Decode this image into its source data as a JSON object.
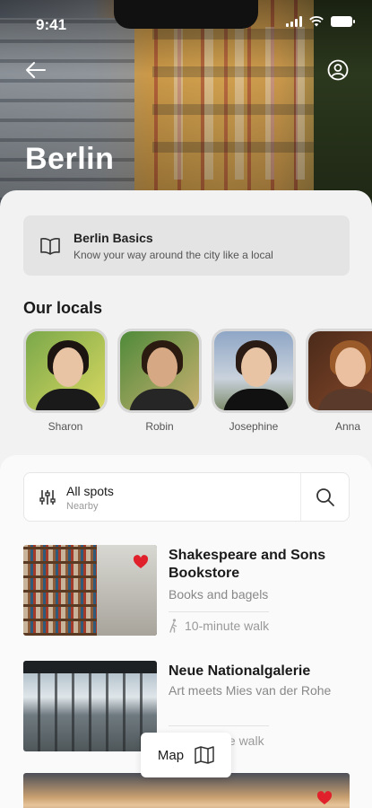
{
  "status_bar": {
    "time": "9:41"
  },
  "hero": {
    "title": "Berlin"
  },
  "basics": {
    "title": "Berlin Basics",
    "subtitle": "Know your way around the city like a local"
  },
  "locals": {
    "heading": "Our locals",
    "people": [
      {
        "name": "Sharon"
      },
      {
        "name": "Robin"
      },
      {
        "name": "Josephine"
      },
      {
        "name": "Anna"
      }
    ]
  },
  "filter": {
    "title": "All spots",
    "subtitle": "Nearby"
  },
  "spots": [
    {
      "title": "Shakespeare and Sons Bookstore",
      "description": "Books and bagels",
      "walk": "10-minute walk",
      "favorited": true
    },
    {
      "title": "Neue Nationalgalerie",
      "description": "Art meets Mies van der Rohe",
      "walk": "te walk",
      "favorited": false
    },
    {
      "favorited": true
    }
  ],
  "map_button": {
    "label": "Map"
  },
  "icons": [
    "back-arrow-icon",
    "profile-icon",
    "book-icon",
    "sliders-icon",
    "search-icon",
    "heart-icon",
    "walk-icon",
    "map-icon"
  ],
  "colors": {
    "accent_heart": "#e0202a",
    "sheet": "#f2f2f2",
    "card_bg": "#e4e4e4"
  }
}
